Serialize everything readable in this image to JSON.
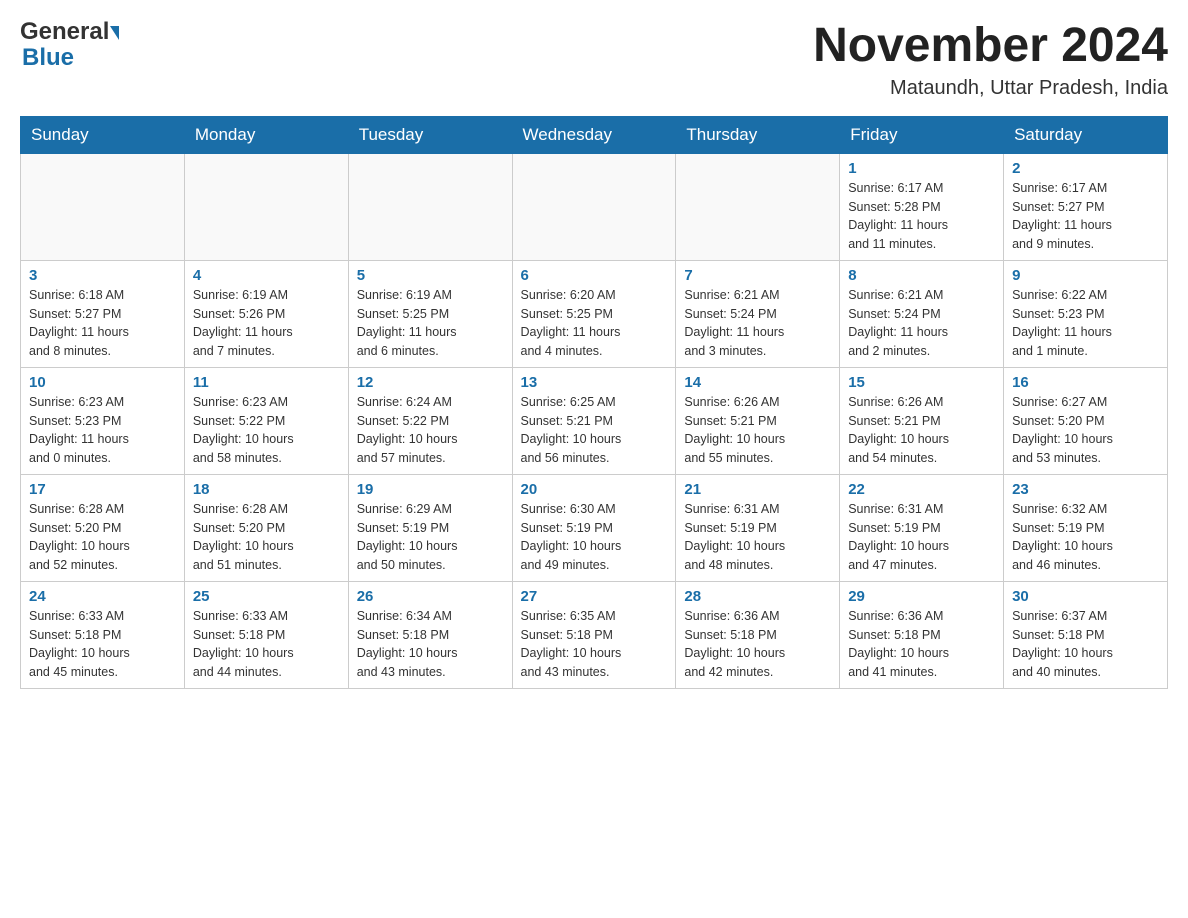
{
  "header": {
    "month_title": "November 2024",
    "location": "Mataundh, Uttar Pradesh, India",
    "logo_general": "General",
    "logo_blue": "Blue"
  },
  "days_of_week": [
    "Sunday",
    "Monday",
    "Tuesday",
    "Wednesday",
    "Thursday",
    "Friday",
    "Saturday"
  ],
  "weeks": [
    [
      {
        "day": "",
        "info": ""
      },
      {
        "day": "",
        "info": ""
      },
      {
        "day": "",
        "info": ""
      },
      {
        "day": "",
        "info": ""
      },
      {
        "day": "",
        "info": ""
      },
      {
        "day": "1",
        "info": "Sunrise: 6:17 AM\nSunset: 5:28 PM\nDaylight: 11 hours\nand 11 minutes."
      },
      {
        "day": "2",
        "info": "Sunrise: 6:17 AM\nSunset: 5:27 PM\nDaylight: 11 hours\nand 9 minutes."
      }
    ],
    [
      {
        "day": "3",
        "info": "Sunrise: 6:18 AM\nSunset: 5:27 PM\nDaylight: 11 hours\nand 8 minutes."
      },
      {
        "day": "4",
        "info": "Sunrise: 6:19 AM\nSunset: 5:26 PM\nDaylight: 11 hours\nand 7 minutes."
      },
      {
        "day": "5",
        "info": "Sunrise: 6:19 AM\nSunset: 5:25 PM\nDaylight: 11 hours\nand 6 minutes."
      },
      {
        "day": "6",
        "info": "Sunrise: 6:20 AM\nSunset: 5:25 PM\nDaylight: 11 hours\nand 4 minutes."
      },
      {
        "day": "7",
        "info": "Sunrise: 6:21 AM\nSunset: 5:24 PM\nDaylight: 11 hours\nand 3 minutes."
      },
      {
        "day": "8",
        "info": "Sunrise: 6:21 AM\nSunset: 5:24 PM\nDaylight: 11 hours\nand 2 minutes."
      },
      {
        "day": "9",
        "info": "Sunrise: 6:22 AM\nSunset: 5:23 PM\nDaylight: 11 hours\nand 1 minute."
      }
    ],
    [
      {
        "day": "10",
        "info": "Sunrise: 6:23 AM\nSunset: 5:23 PM\nDaylight: 11 hours\nand 0 minutes."
      },
      {
        "day": "11",
        "info": "Sunrise: 6:23 AM\nSunset: 5:22 PM\nDaylight: 10 hours\nand 58 minutes."
      },
      {
        "day": "12",
        "info": "Sunrise: 6:24 AM\nSunset: 5:22 PM\nDaylight: 10 hours\nand 57 minutes."
      },
      {
        "day": "13",
        "info": "Sunrise: 6:25 AM\nSunset: 5:21 PM\nDaylight: 10 hours\nand 56 minutes."
      },
      {
        "day": "14",
        "info": "Sunrise: 6:26 AM\nSunset: 5:21 PM\nDaylight: 10 hours\nand 55 minutes."
      },
      {
        "day": "15",
        "info": "Sunrise: 6:26 AM\nSunset: 5:21 PM\nDaylight: 10 hours\nand 54 minutes."
      },
      {
        "day": "16",
        "info": "Sunrise: 6:27 AM\nSunset: 5:20 PM\nDaylight: 10 hours\nand 53 minutes."
      }
    ],
    [
      {
        "day": "17",
        "info": "Sunrise: 6:28 AM\nSunset: 5:20 PM\nDaylight: 10 hours\nand 52 minutes."
      },
      {
        "day": "18",
        "info": "Sunrise: 6:28 AM\nSunset: 5:20 PM\nDaylight: 10 hours\nand 51 minutes."
      },
      {
        "day": "19",
        "info": "Sunrise: 6:29 AM\nSunset: 5:19 PM\nDaylight: 10 hours\nand 50 minutes."
      },
      {
        "day": "20",
        "info": "Sunrise: 6:30 AM\nSunset: 5:19 PM\nDaylight: 10 hours\nand 49 minutes."
      },
      {
        "day": "21",
        "info": "Sunrise: 6:31 AM\nSunset: 5:19 PM\nDaylight: 10 hours\nand 48 minutes."
      },
      {
        "day": "22",
        "info": "Sunrise: 6:31 AM\nSunset: 5:19 PM\nDaylight: 10 hours\nand 47 minutes."
      },
      {
        "day": "23",
        "info": "Sunrise: 6:32 AM\nSunset: 5:19 PM\nDaylight: 10 hours\nand 46 minutes."
      }
    ],
    [
      {
        "day": "24",
        "info": "Sunrise: 6:33 AM\nSunset: 5:18 PM\nDaylight: 10 hours\nand 45 minutes."
      },
      {
        "day": "25",
        "info": "Sunrise: 6:33 AM\nSunset: 5:18 PM\nDaylight: 10 hours\nand 44 minutes."
      },
      {
        "day": "26",
        "info": "Sunrise: 6:34 AM\nSunset: 5:18 PM\nDaylight: 10 hours\nand 43 minutes."
      },
      {
        "day": "27",
        "info": "Sunrise: 6:35 AM\nSunset: 5:18 PM\nDaylight: 10 hours\nand 43 minutes."
      },
      {
        "day": "28",
        "info": "Sunrise: 6:36 AM\nSunset: 5:18 PM\nDaylight: 10 hours\nand 42 minutes."
      },
      {
        "day": "29",
        "info": "Sunrise: 6:36 AM\nSunset: 5:18 PM\nDaylight: 10 hours\nand 41 minutes."
      },
      {
        "day": "30",
        "info": "Sunrise: 6:37 AM\nSunset: 5:18 PM\nDaylight: 10 hours\nand 40 minutes."
      }
    ]
  ]
}
